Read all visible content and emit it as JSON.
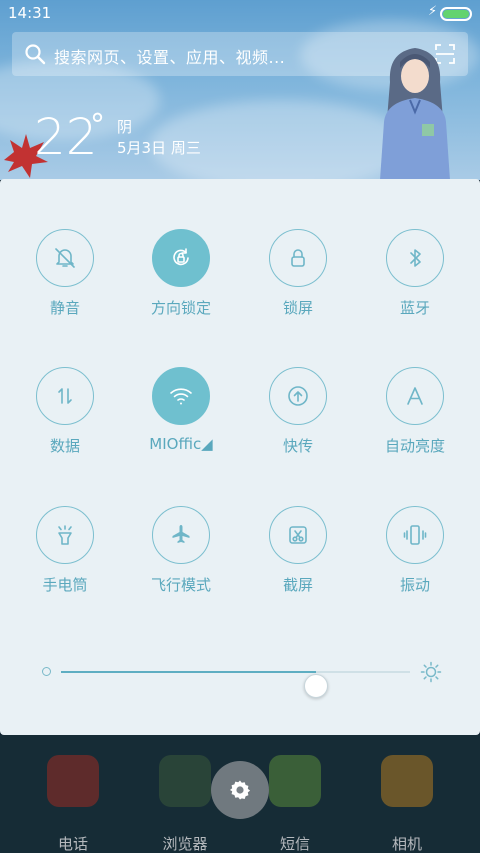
{
  "status_bar": {
    "time": "14:31",
    "battery_level": 1.0
  },
  "search": {
    "placeholder": "搜索网页、设置、应用、视频..."
  },
  "weather": {
    "temperature": "22",
    "degree_symbol": "°",
    "condition": "阴",
    "date": "5月3日 周三"
  },
  "toggles": [
    {
      "label": "静音",
      "icon": "silent-bell-icon",
      "active": false
    },
    {
      "label": "方向锁定",
      "icon": "rotation-lock-icon",
      "active": true
    },
    {
      "label": "锁屏",
      "icon": "lock-icon",
      "active": false
    },
    {
      "label": "蓝牙",
      "icon": "bluetooth-icon",
      "active": false
    },
    {
      "label": "数据",
      "icon": "mobile-data-icon",
      "active": false
    },
    {
      "label": "MIOffic◢",
      "icon": "wifi-icon",
      "active": true
    },
    {
      "label": "快传",
      "icon": "quick-transfer-icon",
      "active": false
    },
    {
      "label": "自动亮度",
      "icon": "auto-brightness-icon",
      "active": false
    },
    {
      "label": "手电筒",
      "icon": "flashlight-icon",
      "active": false
    },
    {
      "label": "飞行模式",
      "icon": "airplane-icon",
      "active": false
    },
    {
      "label": "截屏",
      "icon": "screenshot-icon",
      "active": false
    },
    {
      "label": "振动",
      "icon": "vibrate-icon",
      "active": false
    }
  ],
  "brightness": {
    "level": 0.73
  },
  "dock": {
    "apps": [
      {
        "label": "电话",
        "icon": "phone-icon"
      },
      {
        "label": "浏览器",
        "icon": "browser-icon"
      },
      {
        "label": "短信",
        "icon": "messages-icon"
      },
      {
        "label": "相机",
        "icon": "camera-icon"
      }
    ]
  },
  "colors": {
    "accent": "#6fc0cf",
    "panel": "#e9f1f5",
    "label": "#5aa8bd"
  }
}
